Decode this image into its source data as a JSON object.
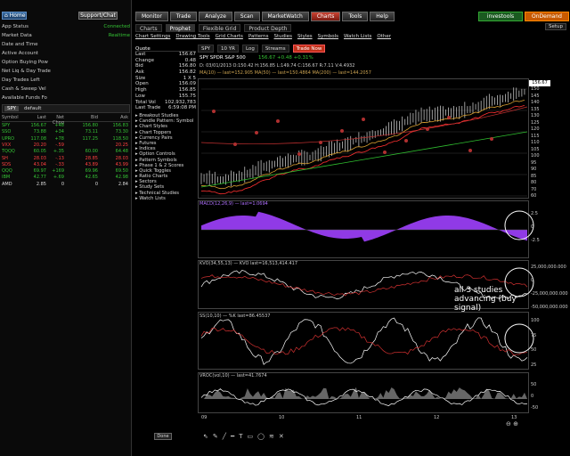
{
  "left": {
    "home": "Home",
    "support": "Support/Chat",
    "account_rows": [
      {
        "label": "App Status",
        "value": "Connected"
      },
      {
        "label": "Market Data",
        "value": "Realtime"
      },
      {
        "label": "Date and Time",
        "value": ""
      },
      {
        "label": "Active Account",
        "value": ""
      },
      {
        "label": "Option Buying Pow",
        "value": ""
      },
      {
        "label": "Net Liq & Day Trade",
        "value": ""
      },
      {
        "label": "Day Trades Left",
        "value": ""
      },
      {
        "label": "Cash & Sweep Vel",
        "value": ""
      },
      {
        "label": "Available Funds Fo",
        "value": ""
      }
    ],
    "toolbar": {
      "symbol": "SPY",
      "group": "default"
    },
    "quote_headers": [
      "Symbol",
      "Last",
      "Net Chng",
      "Bid",
      "Ask"
    ],
    "quotes": [
      {
        "sym": "SPY",
        "last": "156.67",
        "chg": "+48",
        "bid": "156.80",
        "ask": "156.83",
        "color": "#35c435"
      },
      {
        "sym": "SSO",
        "last": "73.88",
        "chg": "+34",
        "bid": "73.11",
        "ask": "73.30",
        "color": "#35c435"
      },
      {
        "sym": "UPRO",
        "last": "117.08",
        "chg": "+78",
        "bid": "117.25",
        "ask": "118.50",
        "color": "#35c435"
      },
      {
        "sym": "VXX",
        "last": "20.20",
        "chg": "-.59",
        "bid": "",
        "ask": "20.25",
        "color": "#ff4040"
      },
      {
        "sym": "TQQQ",
        "last": "60.05",
        "chg": "+.35",
        "bid": "60.00",
        "ask": "64.48",
        "color": "#35c435"
      },
      {
        "sym": "SH",
        "last": "28.03",
        "chg": "-.13",
        "bid": "28.85",
        "ask": "28.03",
        "color": "#ff4040"
      },
      {
        "sym": "SDS",
        "last": "43.04",
        "chg": "-.33",
        "bid": "43.89",
        "ask": "43.99",
        "color": "#ff4040"
      },
      {
        "sym": "QQQ",
        "last": "69.97",
        "chg": "+169",
        "bid": "69.96",
        "ask": "69.50",
        "color": "#35c435"
      },
      {
        "sym": "IBM",
        "last": "42.77",
        "chg": "+.69",
        "bid": "42.65",
        "ask": "42.98",
        "color": "#35c435"
      },
      {
        "sym": "AMD",
        "last": "2.85",
        "chg": "0",
        "bid": "0",
        "ask": "2.84",
        "color": "#dddddd"
      }
    ]
  },
  "nav": {
    "tabs": [
      "Monitor",
      "Trade",
      "Analyze",
      "Scan",
      "MarketWatch",
      "Charts",
      "Tools",
      "Help"
    ],
    "active": "Charts",
    "investools": "investools",
    "ondemand": "OnDemand",
    "subtabs": [
      "Charts",
      "Prophet",
      "Flexible Grid",
      "Product Depth"
    ],
    "menu": [
      "Chart Settings",
      "Drawing Tools",
      "Grid Charts",
      "Patterns",
      "Studies",
      "Styles",
      "Symbols",
      "Watch Lists",
      "Other"
    ],
    "symbol": "SPY",
    "period": "10 YR",
    "log": "Log",
    "streams": "Streams",
    "tradenow": "Trade Now",
    "setup": "Setup"
  },
  "quote": {
    "title": "Quote",
    "rows": [
      {
        "k": "Last",
        "v": "156.67"
      },
      {
        "k": "Change",
        "v": "0.48"
      },
      {
        "k": "Bid",
        "v": "156.80"
      },
      {
        "k": "Ask",
        "v": "156.82"
      },
      {
        "k": "Size",
        "v": "1 X 5"
      },
      {
        "k": "Open",
        "v": "156.09"
      },
      {
        "k": "High",
        "v": "156.85"
      },
      {
        "k": "Low",
        "v": "155.75"
      },
      {
        "k": "Total Vol",
        "v": "102,932,783"
      },
      {
        "k": "Last Trade",
        "v": "6:59:08 PM"
      }
    ]
  },
  "studies": [
    "Breakout Studies",
    "Candle Pattern: Symbol",
    "Chart Styles",
    "Chart Toppers",
    "Currency Pairs",
    "Futures",
    "Indices",
    "Option Controls",
    "Pattern Symbols",
    "Phase 1 & 2 Scores",
    "Quick Toggles",
    "Ratio Charts",
    "Sectors",
    "Study Sets",
    "Technical Studies",
    "Watch Lists"
  ],
  "done": "Done",
  "chart": {
    "title": "SPY SPDR S&P 500",
    "price_info": "156.67 +0.48 +0.31%",
    "ohlc": "D: 03/01/2013 O:150.42 H:156.85 L:149.74 C:156.67 R:7.11 V:4.4932",
    "ma_line": "MA(10) — last=152.905   MA(50) — last=150.4864   MA(200) — last=144.2057",
    "macd_title": "MACD(12,26,9) — last=1.0694",
    "kvo_title": "KVO(34,55,13) — KVO last=16,513,414.417",
    "ss_title": "SS(10,10) — %K last=86.45537",
    "vroc_title": "VROC(vol,10) — last=41.7674",
    "price_axis": [
      "150",
      "145",
      "140",
      "135",
      "130",
      "125",
      "120",
      "115",
      "110",
      "105",
      "100",
      "95",
      "90",
      "85",
      "80",
      "70",
      "60"
    ],
    "last_price_tag": "156.67",
    "macd_axis": [
      "2.5",
      "0",
      "-2.5"
    ],
    "kvo_axis": [
      "25,000,000.000",
      "0",
      "-25,000,000.000",
      "-50,000,000.000"
    ],
    "ss_axis": [
      "100",
      "75",
      "50",
      "25"
    ],
    "vroc_axis": [
      "50",
      "0",
      "-50"
    ],
    "x_labels": [
      "09",
      "10",
      "11",
      "12",
      "13"
    ],
    "annotation": "all 3 studies advancing (buy signal)"
  }
}
